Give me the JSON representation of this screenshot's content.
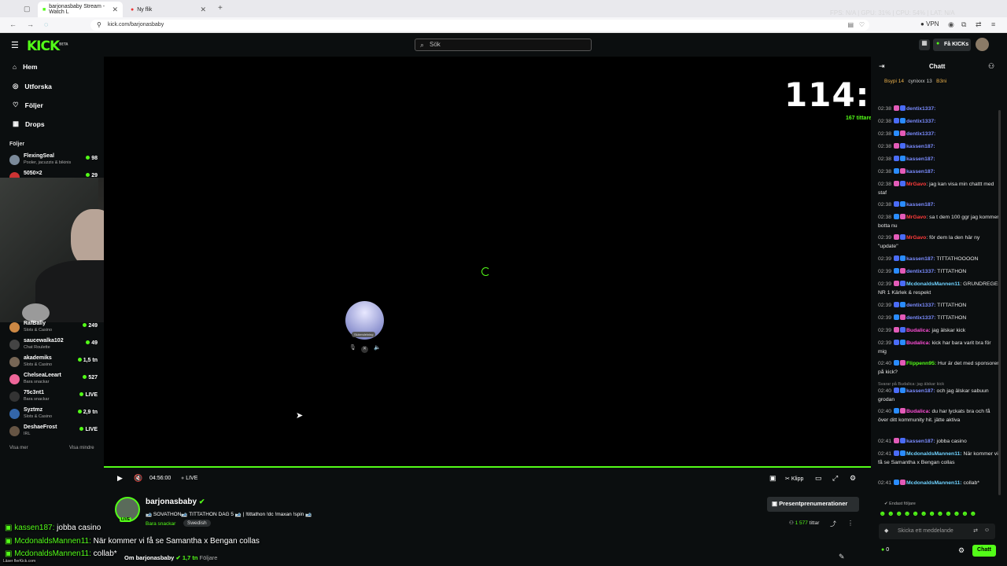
{
  "browser": {
    "tabs": [
      {
        "title": "barjonasbaby Stream - Watch L"
      },
      {
        "title": "Ny flik"
      }
    ],
    "url": "kick.com/barjonasbaby",
    "vpn": "VPN",
    "overlay": "FPS: N/A | GPU: 31% | CPU: 54% | LAT: N/A"
  },
  "header": {
    "logo": "KICK",
    "beta": "BETA",
    "search_placeholder": "Sök",
    "get_kicks": "Få KICKs"
  },
  "sidebar": {
    "nav": [
      {
        "label": "Hem",
        "icon": "home-icon"
      },
      {
        "label": "Utforska",
        "icon": "compass-icon"
      },
      {
        "label": "Följer",
        "icon": "heart-icon"
      },
      {
        "label": "Drops",
        "icon": "drops-icon"
      }
    ],
    "following_title": "Följer",
    "following": [
      {
        "name": "FlexingSeal",
        "category": "Pooler, jacuzzis & bikinis",
        "viewers": "98"
      },
      {
        "name": "5050×2",
        "category": "",
        "viewers": "29"
      },
      {
        "name": "RafBally",
        "category": "Slots & Casino",
        "viewers": "249"
      },
      {
        "name": "saucewalka102",
        "category": "Chat Roulette",
        "viewers": "49"
      },
      {
        "name": "akademiks",
        "category": "Slots & Casino",
        "viewers": "1,5 tn"
      },
      {
        "name": "ChelseaLeeart",
        "category": "Bara snackar",
        "viewers": "527"
      },
      {
        "name": "75c3nt1",
        "category": "Bara snackar",
        "viewers": "LIVE"
      },
      {
        "name": "Syztmz",
        "category": "Slots & Casino",
        "viewers": "2,9 tn"
      },
      {
        "name": "DeshaeFrost",
        "category": "IRL",
        "viewers": "LIVE"
      }
    ],
    "show_more": "Visa mer",
    "show_less": "Visa mindre"
  },
  "player": {
    "timer": "114:26:38",
    "viewers_on_kick": "167 tittare på Kick",
    "elapsed": "04:56:00",
    "live": "LIVE",
    "clip": "Klipp",
    "popup_label": "Skärmdelning"
  },
  "stream": {
    "streamer": "barjonasbaby",
    "title": "🎿 SOVATHON🎿 TITTATHON DAG 5 🎿 | !tittathon !dc !maxan !spin 🎿",
    "category": "Bara snackar",
    "tag": "Swedish",
    "viewers": "1 577",
    "viewers_label": "tittar",
    "gift_subs": "Presentprenumerationer",
    "about_prefix": "Om barjonasbaby",
    "followers": "1,7 tn",
    "followers_label": "Följare"
  },
  "overlay_chat": [
    {
      "user": "kassen187:",
      "text": " jobba casino",
      "color": "#53fc18"
    },
    {
      "user": "McdonaldsMannen11:",
      "text": " När kommer vi få se Samantha x Bengan collas",
      "color": "#53fc18"
    },
    {
      "user": "McdonaldsMannen11:",
      "text": " collab*",
      "color": "#53fc18"
    }
  ],
  "chat": {
    "title": "Chatt",
    "pinned": [
      "Bsypi 14",
      "cynixxx 13",
      "B3ni"
    ],
    "messages": [
      {
        "time": "02:38",
        "user": "dentix1337:",
        "text": " ",
        "color": "#7b8cff"
      },
      {
        "time": "02:38",
        "user": "dentix1337:",
        "text": " ",
        "color": "#7b8cff"
      },
      {
        "time": "02:38",
        "user": "dentix1337:",
        "text": " ",
        "color": "#7b8cff"
      },
      {
        "time": "02:38",
        "user": "kassen187:",
        "text": " ",
        "color": "#7b8cff"
      },
      {
        "time": "02:38",
        "user": "kassen187:",
        "text": " ",
        "color": "#7b8cff"
      },
      {
        "time": "02:38",
        "user": "kassen187:",
        "text": " ",
        "color": "#7b8cff"
      },
      {
        "time": "02:38",
        "user": "MrGavo",
        "text": ": jag kan visa min chattt med staf",
        "color": "#ff3b3b"
      },
      {
        "time": "02:38",
        "user": "kassen187:",
        "text": " ",
        "color": "#7b8cff"
      },
      {
        "time": "02:38",
        "user": "MrGavo",
        "text": ": sa t dem 100 ggr jag kommer botta nu",
        "color": "#ff3b3b"
      },
      {
        "time": "02:39",
        "user": "MrGavo",
        "text": ": för dem la den här ny \"update\"",
        "color": "#ff3b3b"
      },
      {
        "time": "02:39",
        "user": "kassen187:",
        "text": " TITTATHOOOON",
        "color": "#7b8cff"
      },
      {
        "time": "02:39",
        "user": "dentix1337:",
        "text": " TITTATHON",
        "color": "#7b8cff"
      },
      {
        "time": "02:39",
        "user": "McdonaldsMannen11",
        "text": ": GRUNDREGEL NR 1 Kärlek & respekt",
        "color": "#6fd2ff"
      },
      {
        "time": "02:39",
        "user": "dentix1337:",
        "text": " TITTATHON",
        "color": "#7b8cff"
      },
      {
        "time": "02:39",
        "user": "dentix1337:",
        "text": " TITTATHON",
        "color": "#7b8cff"
      },
      {
        "time": "02:39",
        "user": "Budalica:",
        "text": " jag älskar kick",
        "color": "#ff4fd8"
      },
      {
        "time": "02:39",
        "user": "Budalica:",
        "text": " kick har bara varit bra för mig",
        "color": "#ff4fd8"
      },
      {
        "time": "02:40",
        "user": "Flippenn95:",
        "text": " Hur är det med sponsorer på kick?",
        "color": "#53fc18"
      },
      {
        "time": "",
        "user": "",
        "text": "Svarar på Budalica: jag älskar kick",
        "color": "#888"
      },
      {
        "time": "02:40",
        "user": "kassen187:",
        "text": " och jag älskar sabuun grodan",
        "color": "#7b8cff"
      },
      {
        "time": "02:40",
        "user": "Budalica:",
        "text": " du har lyckats bra och få över ditt kommunity hit. jätte aktiva",
        "color": "#ff4fd8"
      },
      {
        "time": "02:41",
        "user": "kassen187:",
        "text": " jobba casino",
        "color": "#7b8cff"
      },
      {
        "time": "02:41",
        "user": "McdonaldsMannen11:",
        "text": " När kommer vi få se Samantha x Bengan collas",
        "color": "#6fd2ff"
      },
      {
        "time": "02:41",
        "user": "McdonaldsMannen11:",
        "text": " collab*",
        "color": "#6fd2ff"
      }
    ],
    "followers_only": "Endast följare",
    "input_placeholder": "Skicka ett meddelande",
    "points": "0",
    "send": "Chatt"
  },
  "cursor_status": "Läser flerKick.com"
}
